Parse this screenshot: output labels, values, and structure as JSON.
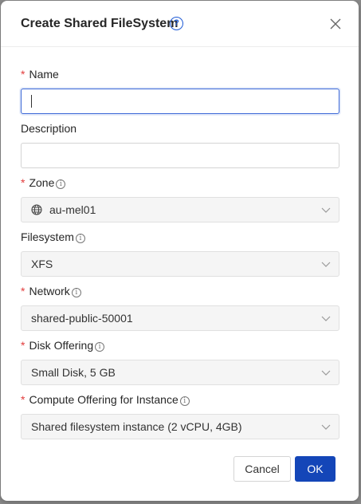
{
  "dialog": {
    "title": "Create Shared FileSystem",
    "help_glyph": "?",
    "close_glyph": "×"
  },
  "form": {
    "required_mark": "*",
    "info_glyph": "i",
    "name": {
      "label": "Name",
      "value": ""
    },
    "description": {
      "label": "Description",
      "value": ""
    },
    "zone": {
      "label": "Zone",
      "value": "au-mel01",
      "icon": "globe-icon"
    },
    "filesystem": {
      "label": "Filesystem",
      "value": "XFS"
    },
    "network": {
      "label": "Network",
      "value": "shared-public-50001"
    },
    "disk_offering": {
      "label": "Disk Offering",
      "value": "Small Disk, 5 GB"
    },
    "compute_offering": {
      "label": "Compute Offering for Instance",
      "value": "Shared filesystem instance (2 vCPU, 4GB)"
    }
  },
  "footer": {
    "cancel_label": "Cancel",
    "ok_label": "OK"
  },
  "colors": {
    "primary": "#1446b8",
    "required": "#e23c3c",
    "focus_border": "#3a67d6"
  }
}
